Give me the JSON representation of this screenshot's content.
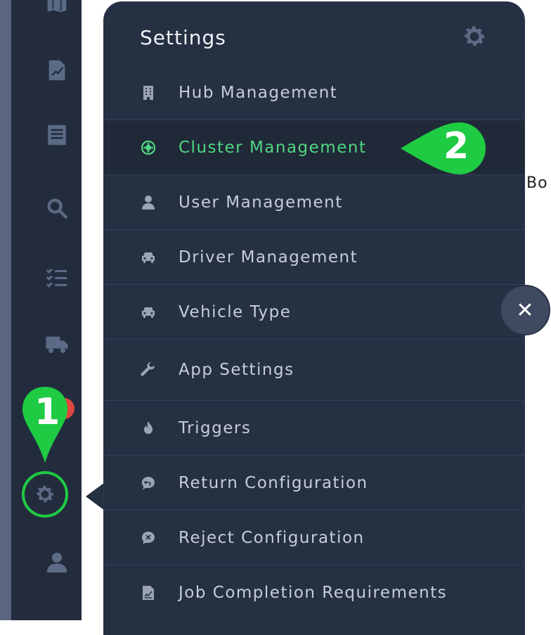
{
  "background": {
    "partial_text": "Bo"
  },
  "sidebar": {
    "icons": [
      {
        "name": "map-icon"
      },
      {
        "name": "edit-document-icon"
      },
      {
        "name": "list-document-icon"
      },
      {
        "name": "search-icon"
      },
      {
        "name": "checklist-icon"
      },
      {
        "name": "truck-icon"
      },
      {
        "name": "settings-gear-icon"
      },
      {
        "name": "user-icon"
      }
    ]
  },
  "panel": {
    "title": "Settings",
    "items": [
      {
        "label": "Hub Management",
        "icon": "building-icon"
      },
      {
        "label": "Cluster Management",
        "icon": "cluster-icon",
        "active": true
      },
      {
        "label": "User Management",
        "icon": "user-icon"
      },
      {
        "label": "Driver Management",
        "icon": "car-icon"
      },
      {
        "label": "Vehicle Type",
        "icon": "car-icon"
      },
      {
        "label": "App Settings",
        "icon": "wrench-icon"
      },
      {
        "label": "Triggers",
        "icon": "fire-icon"
      },
      {
        "label": "Return Configuration",
        "icon": "return-chat-icon"
      },
      {
        "label": "Reject Configuration",
        "icon": "reject-chat-icon"
      },
      {
        "label": "Job Completion Requirements",
        "icon": "signature-document-icon"
      }
    ]
  },
  "close_button": {
    "glyph": "✕"
  },
  "markers": [
    {
      "number": "1",
      "color": "#1ecb43"
    },
    {
      "number": "2",
      "color": "#1ecb43"
    }
  ],
  "colors": {
    "sidebar_bg": "#232c3d",
    "panel_bg": "#253042",
    "active_text": "#4fd882",
    "marker_green": "#1ecb43",
    "badge_red": "#e0463f"
  }
}
